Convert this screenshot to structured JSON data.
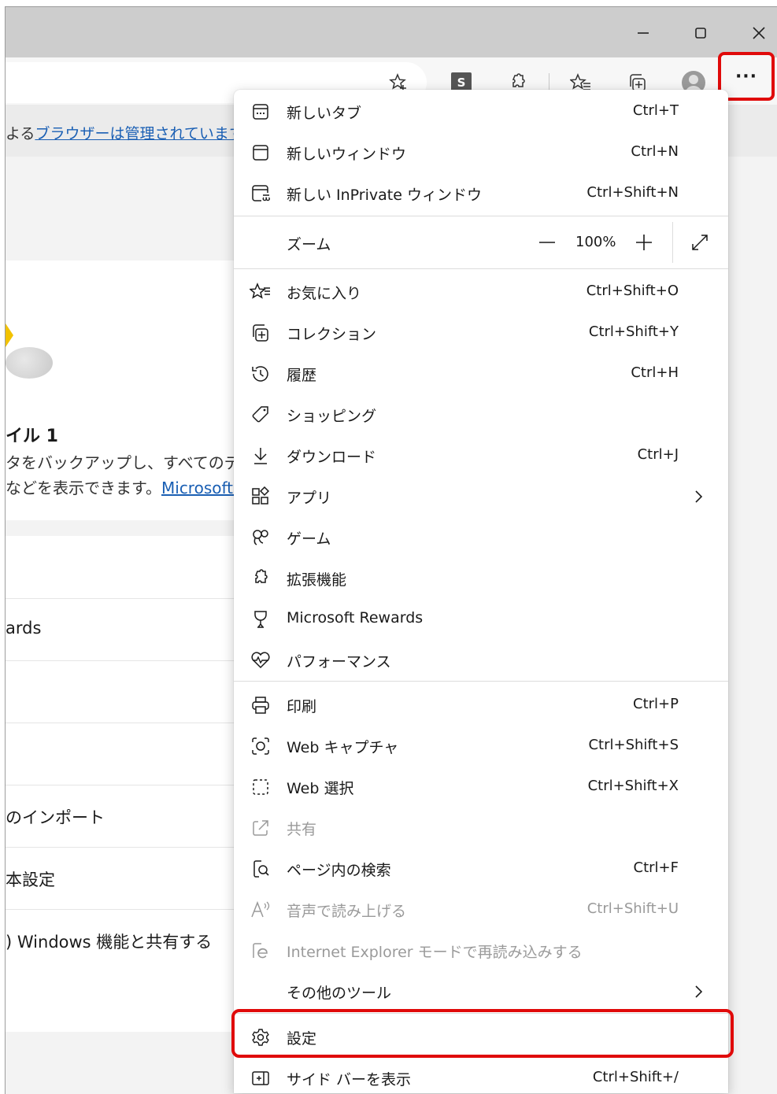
{
  "titlebar": {
    "minimize_icon": "minimize-icon",
    "maximize_icon": "maximize-icon",
    "close_icon": "close-icon"
  },
  "toolbar": {
    "more_label": "···",
    "s_badge": "S",
    "icons": [
      "favorite-add-icon",
      "s-extension-icon",
      "extensions-icon",
      "favorites-icon",
      "collections-icon",
      "profile-icon"
    ]
  },
  "managed": {
    "prefix": "よる",
    "link": "ブラウザーは管理されています"
  },
  "profile_card": {
    "title": "イル 1",
    "line1": "タをバックアップし、すべてのデバイス",
    "line2_prefix": "などを表示できます。",
    "line2_link": "Microsoft アカウント"
  },
  "left_list": {
    "rows": [
      "",
      "ards",
      "",
      "",
      "のインポート",
      "本設定",
      ") Windows 機能と共有する"
    ]
  },
  "menu": {
    "new_tab": {
      "label": "新しいタブ",
      "shortcut": "Ctrl+T"
    },
    "new_window": {
      "label": "新しいウィンドウ",
      "shortcut": "Ctrl+N"
    },
    "new_inprivate": {
      "label": "新しい InPrivate ウィンドウ",
      "shortcut": "Ctrl+Shift+N"
    },
    "zoom": {
      "label": "ズーム",
      "value": "100%",
      "minus": "—",
      "plus": "+"
    },
    "favorites": {
      "label": "お気に入り",
      "shortcut": "Ctrl+Shift+O"
    },
    "collections": {
      "label": "コレクション",
      "shortcut": "Ctrl+Shift+Y"
    },
    "history": {
      "label": "履歴",
      "shortcut": "Ctrl+H"
    },
    "shopping": {
      "label": "ショッピング",
      "shortcut": ""
    },
    "downloads": {
      "label": "ダウンロード",
      "shortcut": "Ctrl+J"
    },
    "apps": {
      "label": "アプリ"
    },
    "games": {
      "label": "ゲーム"
    },
    "extensions": {
      "label": "拡張機能"
    },
    "rewards": {
      "label": "Microsoft Rewards"
    },
    "performance": {
      "label": "パフォーマンス"
    },
    "print": {
      "label": "印刷",
      "shortcut": "Ctrl+P"
    },
    "web_capture": {
      "label": "Web キャプチャ",
      "shortcut": "Ctrl+Shift+S"
    },
    "web_select": {
      "label": "Web 選択",
      "shortcut": "Ctrl+Shift+X"
    },
    "share": {
      "label": "共有"
    },
    "find": {
      "label": "ページ内の検索",
      "shortcut": "Ctrl+F"
    },
    "read_aloud": {
      "label": "音声で読み上げる",
      "shortcut": "Ctrl+Shift+U"
    },
    "ie_mode": {
      "label": "Internet Explorer モードで再読み込みする"
    },
    "more_tools": {
      "label": "その他のツール"
    },
    "settings": {
      "label": "設定"
    },
    "sidebar": {
      "label": "サイド バーを表示",
      "shortcut": "Ctrl+Shift+/"
    }
  },
  "colors": {
    "highlight": "#e00a0a",
    "link": "#1a5fb4"
  }
}
